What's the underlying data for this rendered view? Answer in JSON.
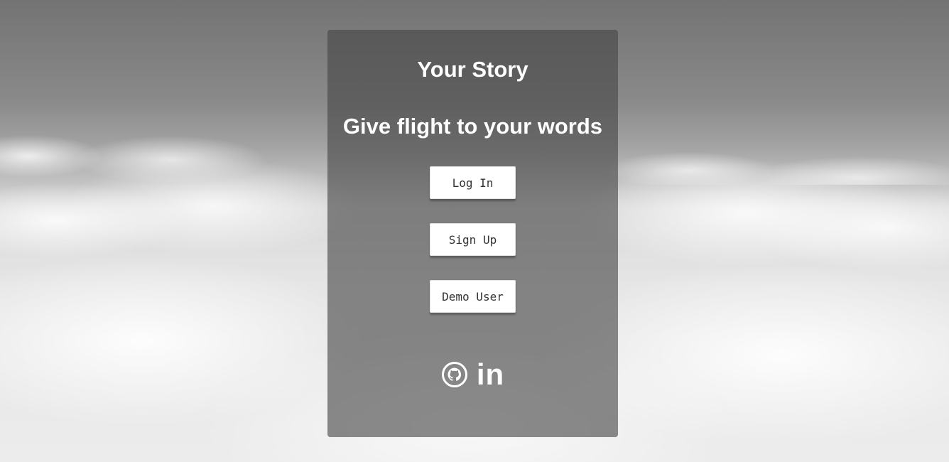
{
  "app": {
    "title": "Your Story",
    "tagline": "Give flight to your words"
  },
  "auth": {
    "login_label": "Log In",
    "signup_label": "Sign Up",
    "demo_label": "Demo User"
  },
  "social": {
    "github_icon": "github-icon",
    "linkedin_icon": "linkedin-icon",
    "linkedin_glyph": "in"
  },
  "colors": {
    "card_background": "#464646",
    "text": "#ffffff",
    "button_background": "#ffffff",
    "button_text": "#333333"
  }
}
